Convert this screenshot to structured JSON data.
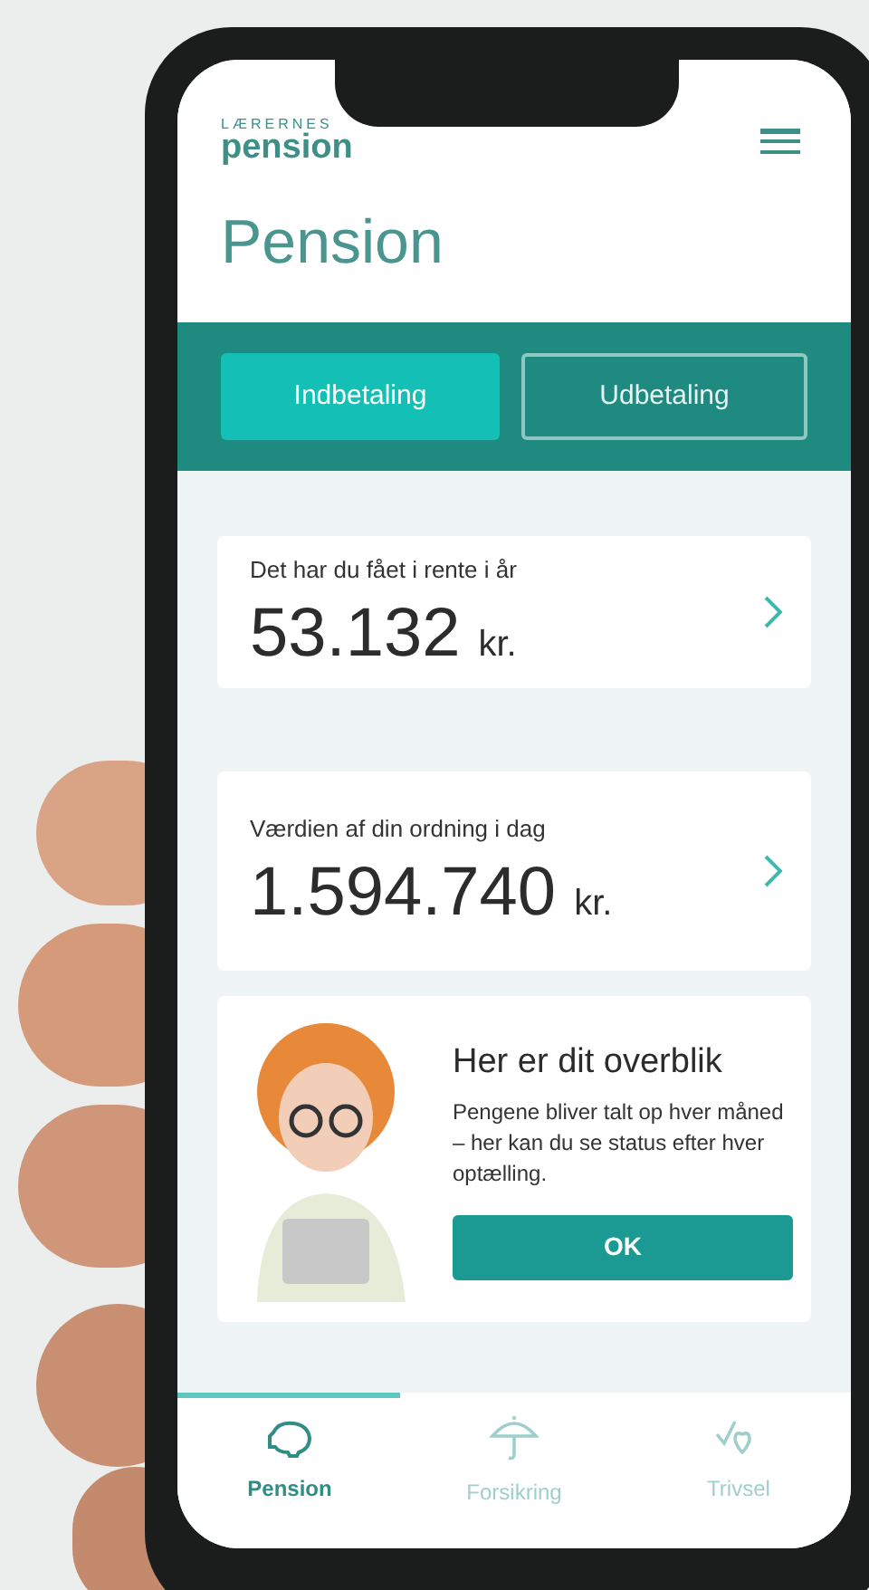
{
  "header": {
    "logo_top": "LÆRERNES",
    "logo_bottom": "pension"
  },
  "title": "Pension",
  "tabs": [
    {
      "label": "Indbetaling",
      "selected": true
    },
    {
      "label": "Udbetaling",
      "selected": false
    }
  ],
  "cards": [
    {
      "label": "Det har du fået i rente i år",
      "amount": "53.132",
      "unit": "kr."
    },
    {
      "label": "Værdien af din ordning i dag",
      "amount": "1.594.740",
      "unit": "kr."
    }
  ],
  "info_card": {
    "heading": "Her er dit overblik",
    "text": "Pengene bliver talt op hver måned – her kan du se status efter hver optælling.",
    "button": "OK"
  },
  "bottom_nav": [
    {
      "label": "Pension",
      "selected": true
    },
    {
      "label": "Forsikring",
      "selected": false
    },
    {
      "label": "Trivsel",
      "selected": false
    }
  ]
}
